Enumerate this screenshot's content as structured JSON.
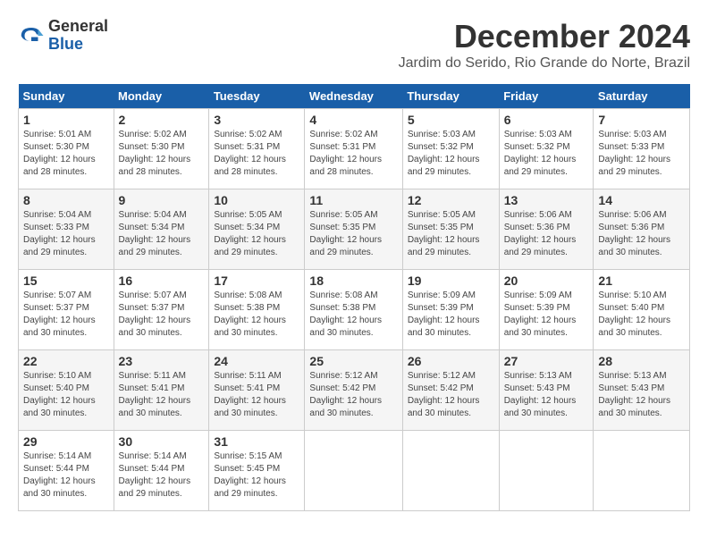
{
  "header": {
    "logo_line1": "General",
    "logo_line2": "Blue",
    "month_title": "December 2024",
    "location": "Jardim do Serido, Rio Grande do Norte, Brazil"
  },
  "weekdays": [
    "Sunday",
    "Monday",
    "Tuesday",
    "Wednesday",
    "Thursday",
    "Friday",
    "Saturday"
  ],
  "weeks": [
    [
      {
        "day": 1,
        "sunrise": "5:01 AM",
        "sunset": "5:30 PM",
        "daylight": "12 hours and 28 minutes."
      },
      {
        "day": 2,
        "sunrise": "5:02 AM",
        "sunset": "5:30 PM",
        "daylight": "12 hours and 28 minutes."
      },
      {
        "day": 3,
        "sunrise": "5:02 AM",
        "sunset": "5:31 PM",
        "daylight": "12 hours and 28 minutes."
      },
      {
        "day": 4,
        "sunrise": "5:02 AM",
        "sunset": "5:31 PM",
        "daylight": "12 hours and 28 minutes."
      },
      {
        "day": 5,
        "sunrise": "5:03 AM",
        "sunset": "5:32 PM",
        "daylight": "12 hours and 29 minutes."
      },
      {
        "day": 6,
        "sunrise": "5:03 AM",
        "sunset": "5:32 PM",
        "daylight": "12 hours and 29 minutes."
      },
      {
        "day": 7,
        "sunrise": "5:03 AM",
        "sunset": "5:33 PM",
        "daylight": "12 hours and 29 minutes."
      }
    ],
    [
      {
        "day": 8,
        "sunrise": "5:04 AM",
        "sunset": "5:33 PM",
        "daylight": "12 hours and 29 minutes."
      },
      {
        "day": 9,
        "sunrise": "5:04 AM",
        "sunset": "5:34 PM",
        "daylight": "12 hours and 29 minutes."
      },
      {
        "day": 10,
        "sunrise": "5:05 AM",
        "sunset": "5:34 PM",
        "daylight": "12 hours and 29 minutes."
      },
      {
        "day": 11,
        "sunrise": "5:05 AM",
        "sunset": "5:35 PM",
        "daylight": "12 hours and 29 minutes."
      },
      {
        "day": 12,
        "sunrise": "5:05 AM",
        "sunset": "5:35 PM",
        "daylight": "12 hours and 29 minutes."
      },
      {
        "day": 13,
        "sunrise": "5:06 AM",
        "sunset": "5:36 PM",
        "daylight": "12 hours and 29 minutes."
      },
      {
        "day": 14,
        "sunrise": "5:06 AM",
        "sunset": "5:36 PM",
        "daylight": "12 hours and 30 minutes."
      }
    ],
    [
      {
        "day": 15,
        "sunrise": "5:07 AM",
        "sunset": "5:37 PM",
        "daylight": "12 hours and 30 minutes."
      },
      {
        "day": 16,
        "sunrise": "5:07 AM",
        "sunset": "5:37 PM",
        "daylight": "12 hours and 30 minutes."
      },
      {
        "day": 17,
        "sunrise": "5:08 AM",
        "sunset": "5:38 PM",
        "daylight": "12 hours and 30 minutes."
      },
      {
        "day": 18,
        "sunrise": "5:08 AM",
        "sunset": "5:38 PM",
        "daylight": "12 hours and 30 minutes."
      },
      {
        "day": 19,
        "sunrise": "5:09 AM",
        "sunset": "5:39 PM",
        "daylight": "12 hours and 30 minutes."
      },
      {
        "day": 20,
        "sunrise": "5:09 AM",
        "sunset": "5:39 PM",
        "daylight": "12 hours and 30 minutes."
      },
      {
        "day": 21,
        "sunrise": "5:10 AM",
        "sunset": "5:40 PM",
        "daylight": "12 hours and 30 minutes."
      }
    ],
    [
      {
        "day": 22,
        "sunrise": "5:10 AM",
        "sunset": "5:40 PM",
        "daylight": "12 hours and 30 minutes."
      },
      {
        "day": 23,
        "sunrise": "5:11 AM",
        "sunset": "5:41 PM",
        "daylight": "12 hours and 30 minutes."
      },
      {
        "day": 24,
        "sunrise": "5:11 AM",
        "sunset": "5:41 PM",
        "daylight": "12 hours and 30 minutes."
      },
      {
        "day": 25,
        "sunrise": "5:12 AM",
        "sunset": "5:42 PM",
        "daylight": "12 hours and 30 minutes."
      },
      {
        "day": 26,
        "sunrise": "5:12 AM",
        "sunset": "5:42 PM",
        "daylight": "12 hours and 30 minutes."
      },
      {
        "day": 27,
        "sunrise": "5:13 AM",
        "sunset": "5:43 PM",
        "daylight": "12 hours and 30 minutes."
      },
      {
        "day": 28,
        "sunrise": "5:13 AM",
        "sunset": "5:43 PM",
        "daylight": "12 hours and 30 minutes."
      }
    ],
    [
      {
        "day": 29,
        "sunrise": "5:14 AM",
        "sunset": "5:44 PM",
        "daylight": "12 hours and 30 minutes."
      },
      {
        "day": 30,
        "sunrise": "5:14 AM",
        "sunset": "5:44 PM",
        "daylight": "12 hours and 29 minutes."
      },
      {
        "day": 31,
        "sunrise": "5:15 AM",
        "sunset": "5:45 PM",
        "daylight": "12 hours and 29 minutes."
      },
      null,
      null,
      null,
      null
    ]
  ]
}
